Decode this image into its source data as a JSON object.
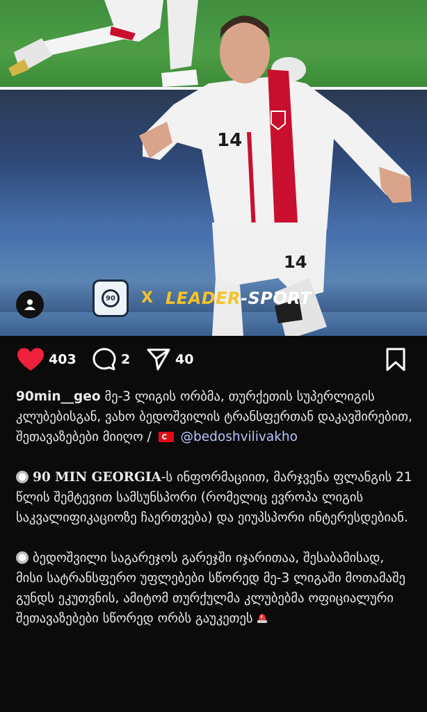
{
  "post": {
    "image": {
      "brand_left": "90",
      "separator": "X",
      "brand_right_primary": "LEADER",
      "brand_right_secondary": "-SPORT",
      "player_number": "14"
    },
    "actions": {
      "likes": "403",
      "comments": "2",
      "shares": "40"
    },
    "caption": {
      "username": "90min__geo",
      "text_1": "მე-3 ლიგის ორბმა, თურქეთის სუპერლიგის კლუბებისგან, ვახო ბედოშვილის ტრანსფერთან დაკავშირებით, შეთავაზებები მიიღო /",
      "mention": "@bedoshvilivakho",
      "para2_bold": "90 MIN GEORGIA",
      "para2_text": "-ს ინფორმაციით, მარჯვენა ფლანგის 21 წლის შემტევით სამსუნსპორი (რომელიც ევროპა ლიგის საკვალიფიკაციოზე ჩაერთვება) და ეიუპსპორი ინტერესდებიან.",
      "para3_text": "ბედოშვილი საგარეჯოს გარეჯში იჯარითაა, შესაბამისად, მისი სატრანსფერო უფლებები სწორედ მე-3 ლიგაში მოთამაშე გუნდს ეკუთვნის, ამიტომ თურქულმა კლუბებმა ოფიციალური შეთავაზებები სწორედ ორბს გაუკეთეს"
    },
    "colors": {
      "like": "#f0213a",
      "brand_yellow": "#f6c329",
      "background": "#0b0b0b"
    },
    "icons": [
      "user-icon",
      "heart-icon",
      "comment-icon",
      "send-icon",
      "bookmark-icon",
      "turkey-flag-icon",
      "siren-icon"
    ]
  }
}
